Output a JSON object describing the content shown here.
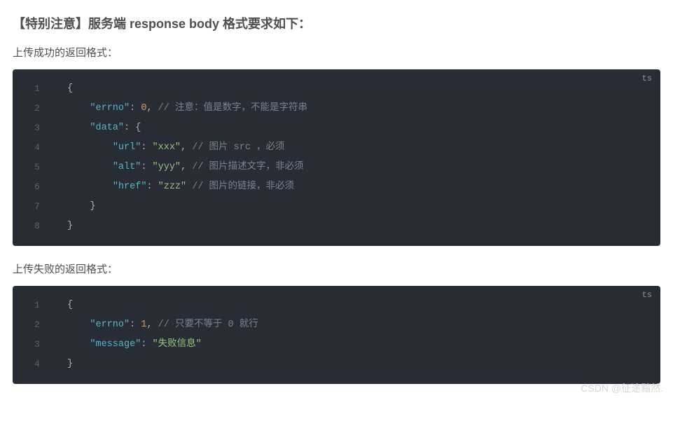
{
  "heading": "【特别注意】服务端 response body 格式要求如下：",
  "section1": {
    "title": "上传成功的返回格式："
  },
  "section2": {
    "title": "上传失败的返回格式："
  },
  "lang": "ts",
  "code1": {
    "lineNums": [
      "1",
      "2",
      "3",
      "4",
      "5",
      "6",
      "7",
      "8"
    ],
    "l1": "{",
    "l2": {
      "pad": "    ",
      "k": "\"errno\"",
      "colon": ": ",
      "v": "0",
      "comma": ", ",
      "cm": "// 注意：值是数字，不能是字符串"
    },
    "l3": {
      "pad": "    ",
      "k": "\"data\"",
      "rest": ": {"
    },
    "l4": {
      "pad": "        ",
      "k": "\"url\"",
      "colon": ": ",
      "v": "\"xxx\"",
      "comma": ", ",
      "cm": "// 图片 src ，必须"
    },
    "l5": {
      "pad": "        ",
      "k": "\"alt\"",
      "colon": ": ",
      "v": "\"yyy\"",
      "comma": ", ",
      "cm": "// 图片描述文字，非必须"
    },
    "l6": {
      "pad": "        ",
      "k": "\"href\"",
      "colon": ": ",
      "v": "\"zzz\"",
      "sp": " ",
      "cm": "// 图片的链接，非必须"
    },
    "l7": "    }",
    "l8": "}"
  },
  "code2": {
    "lineNums": [
      "1",
      "2",
      "3",
      "4"
    ],
    "l1": "{",
    "l2": {
      "pad": "    ",
      "k": "\"errno\"",
      "colon": ": ",
      "v": "1",
      "comma": ", ",
      "cm": "// 只要不等于 0 就行"
    },
    "l3": {
      "pad": "    ",
      "k": "\"message\"",
      "colon": ": ",
      "v": "\"失败信息\""
    },
    "l4": "}"
  },
  "watermark": "CSDN @征途黯然."
}
